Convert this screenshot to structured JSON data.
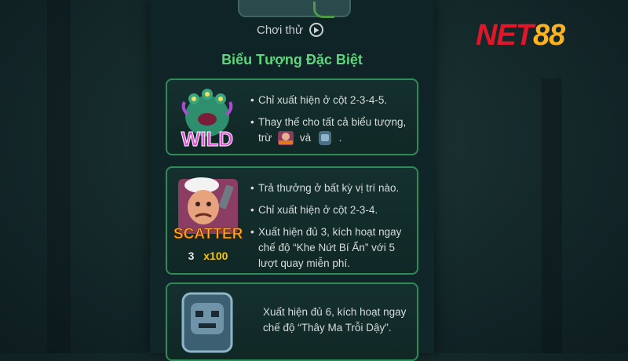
{
  "brand": {
    "part1": "NET",
    "part2": "88"
  },
  "demo": {
    "label": "Chơi thử",
    "icon": "play-circle-icon"
  },
  "section": {
    "title": "Biểu Tượng Đặc Biệt"
  },
  "wild": {
    "symbol_text": "WILD",
    "bullets": [
      "Chỉ xuất hiện ở cột 2-3-4-5.",
      "Thay thế cho tất cả biểu tượng,"
    ],
    "except_prefix": "trừ",
    "except_join": "và",
    "except_suffix": ".",
    "scatter_mini_text": "SCATTER"
  },
  "scatter": {
    "symbol_text": "SCATTER",
    "count": "3",
    "multiplier": "x100",
    "bullets": [
      "Trả thưởng ở bất kỳ vị trí nào.",
      "Chỉ xuất hiện ở cột 2-3-4.",
      "Xuất hiện đủ 3, kích hoạt ngay chế độ “Khe Nứt Bí Ẩn” với 5 lượt quay miễn phí."
    ]
  },
  "bonus": {
    "text": "Xuất hiện đủ 6, kích hoạt ngay chế độ “Thây Ma Trỗi Dậy”."
  },
  "colors": {
    "title_green": "#5fd57c",
    "card_border": "#2f8c56",
    "multiplier": "#f2c21a",
    "logo_red": "#e0162a",
    "logo_gold": "#ffb21c"
  }
}
